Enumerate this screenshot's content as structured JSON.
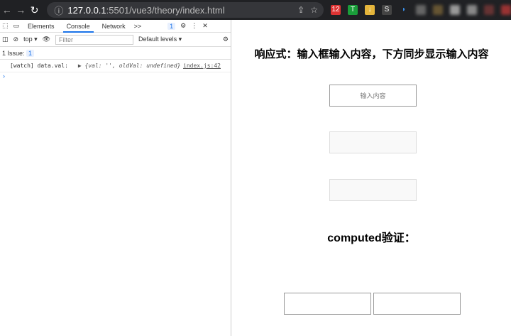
{
  "browser": {
    "url_host": "127.0.0.1",
    "url_rest": ":5501/vue3/theory/index.html",
    "ext_badge": "12"
  },
  "devtools": {
    "tabs": [
      "Elements",
      "Console",
      "Network"
    ],
    "more": ">>",
    "issues_count": "1",
    "context": "top",
    "filter_placeholder": "Filter",
    "levels": "Default levels",
    "issues_label": "1 Issue:",
    "issues_badge": "1",
    "log": {
      "label": "[watch] data.val:",
      "object": "▶ {val: '', oldVal: undefined}",
      "source": "index.js:42"
    },
    "prompt": "›"
  },
  "page": {
    "title": "响应式：输入框输入内容，下方同步显示输入内容",
    "input_placeholder": "输入内容",
    "computed_title": "computed验证："
  }
}
